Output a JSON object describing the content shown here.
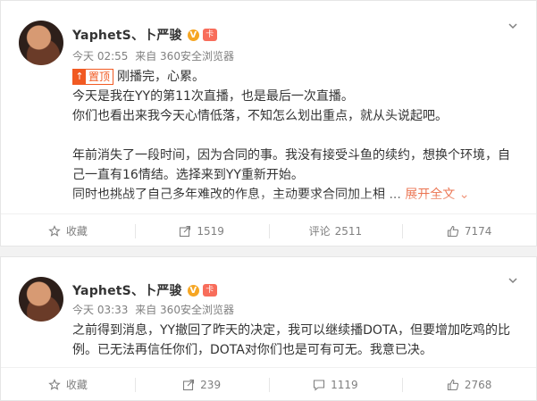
{
  "posts": [
    {
      "username": "YaphetS、卜严骏",
      "vbadge": "V",
      "level": "卡",
      "time": "今天 02:55",
      "source": "来自 360安全浏览器",
      "pin_label": "置顶",
      "pin_icon": "↑",
      "lines": [
        "刚播完，心累。",
        "今天是我在YY的第11次直播，也是最后一次直播。",
        "你们也看出来我今天心情低落，不知怎么划出重点，就从头说起吧。",
        "",
        "年前消失了一段时间，因为合同的事。我没有接受斗鱼的续约，想换个环境，自",
        "己一直有16情结。选择来到YY重新开始。",
        "同时也挑战了自己多年难改的作息，主动要求合同加上相"
      ],
      "expand_label": "展开全文",
      "actions": {
        "favorite": "收藏",
        "repost": "1519",
        "comment_label": "评论",
        "comment": "2511",
        "like": "7174"
      }
    },
    {
      "username": "YaphetS、卜严骏",
      "vbadge": "V",
      "level": "卡",
      "time": "今天 03:33",
      "source": "来自 360安全浏览器",
      "lines": [
        "之前得到消息，YY撤回了昨天的决定，我可以继续播DOTA，但要增加吃鸡的比",
        "例。已无法再信任你们，DOTA对你们也是可有可无。我意已决。"
      ],
      "actions": {
        "favorite": "收藏",
        "repost": "239",
        "comment": "1119",
        "like": "2768"
      }
    }
  ],
  "icons": {
    "menu": "chevron-down-icon",
    "favorite": "star-icon",
    "repost": "share-icon",
    "comment": "comment-icon",
    "like": "thumb-up-icon"
  }
}
